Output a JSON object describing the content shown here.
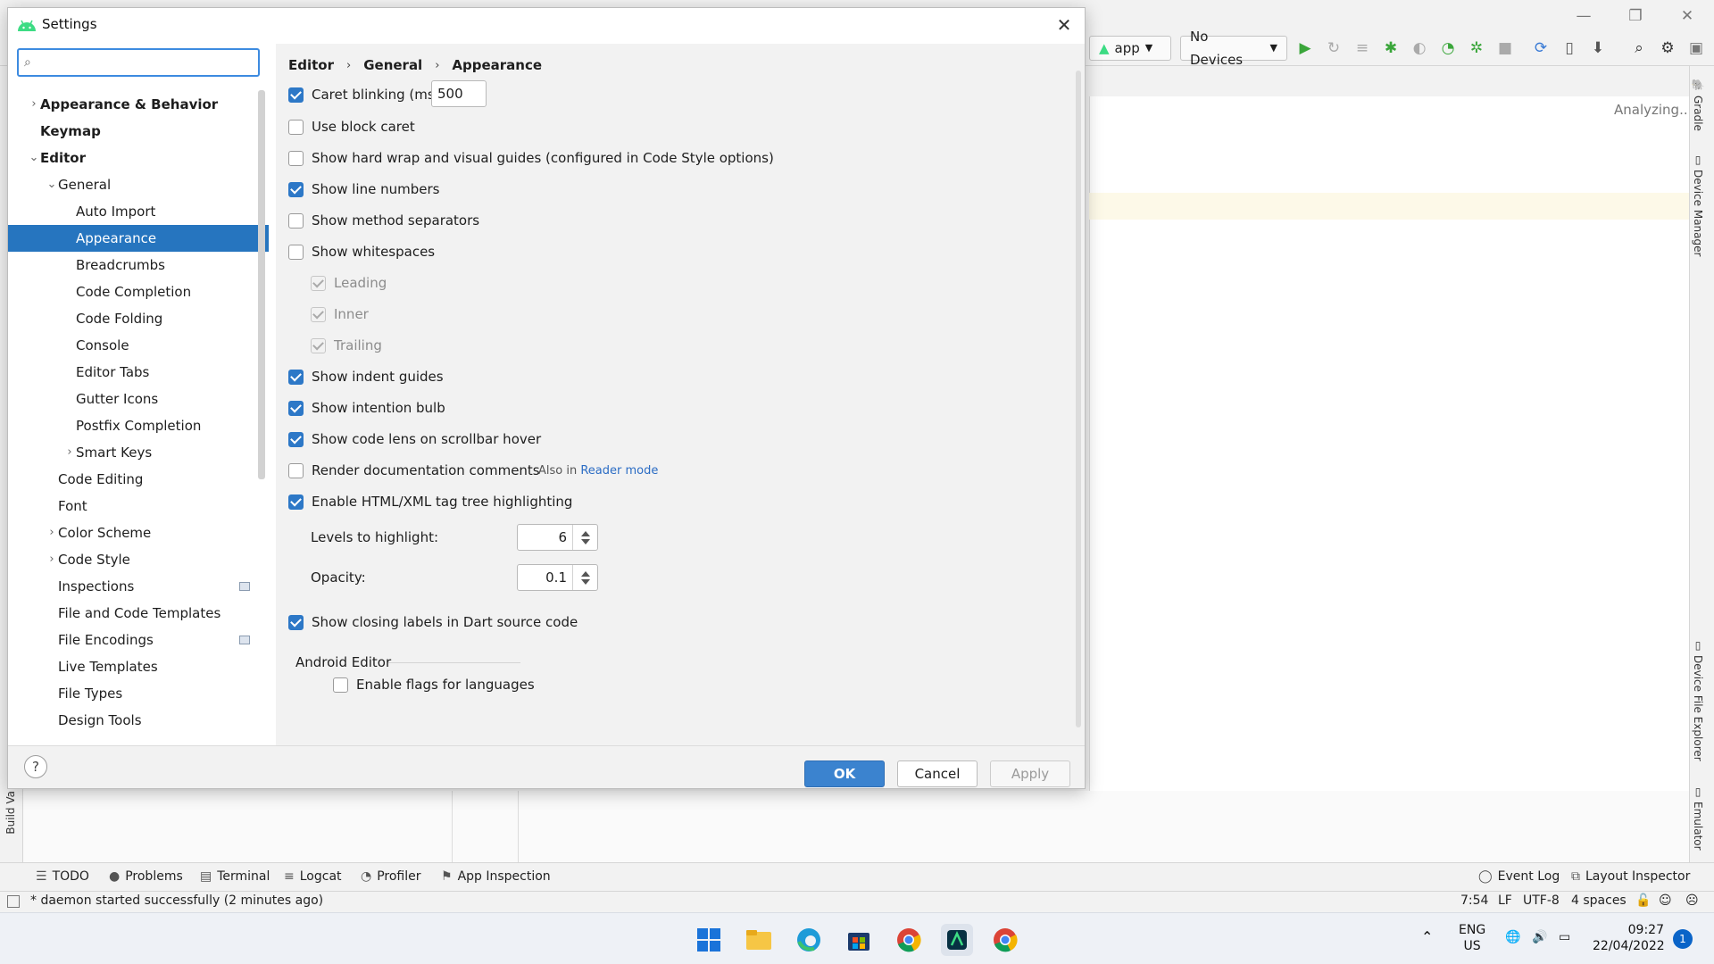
{
  "ide": {
    "run_config": "app",
    "devices": "No Devices",
    "analyzing": "Analyzing...",
    "right_tabs": [
      "Gradle",
      "Device Manager",
      "Device File Explorer",
      "Emulator"
    ],
    "left_tab": "Build Va",
    "tool_windows": [
      "TODO",
      "Problems",
      "Terminal",
      "Logcat",
      "Profiler",
      "App Inspection"
    ],
    "tool_windows_right": [
      "Event Log",
      "Layout Inspector"
    ],
    "status_message": "* daemon started successfully (2 minutes ago)",
    "status_items": [
      "7:54",
      "LF",
      "UTF-8",
      "4 spaces"
    ]
  },
  "taskbar": {
    "lang_top": "ENG",
    "lang_bottom": "US",
    "time": "09:27",
    "date": "22/04/2022",
    "notifications": "1"
  },
  "dialog": {
    "title": "Settings",
    "search": {
      "value": "",
      "placeholder": ""
    },
    "tree": [
      {
        "label": "Appearance & Behavior",
        "indent": 0,
        "bold": true,
        "chevron": "right"
      },
      {
        "label": "Keymap",
        "indent": 0,
        "bold": true,
        "chevron": "none"
      },
      {
        "label": "Editor",
        "indent": 0,
        "bold": true,
        "chevron": "down"
      },
      {
        "label": "General",
        "indent": 1,
        "bold": false,
        "chevron": "down"
      },
      {
        "label": "Auto Import",
        "indent": 2,
        "bold": false,
        "chevron": "none"
      },
      {
        "label": "Appearance",
        "indent": 2,
        "bold": false,
        "chevron": "none",
        "selected": true
      },
      {
        "label": "Breadcrumbs",
        "indent": 2,
        "bold": false,
        "chevron": "none"
      },
      {
        "label": "Code Completion",
        "indent": 2,
        "bold": false,
        "chevron": "none"
      },
      {
        "label": "Code Folding",
        "indent": 2,
        "bold": false,
        "chevron": "none"
      },
      {
        "label": "Console",
        "indent": 2,
        "bold": false,
        "chevron": "none"
      },
      {
        "label": "Editor Tabs",
        "indent": 2,
        "bold": false,
        "chevron": "none"
      },
      {
        "label": "Gutter Icons",
        "indent": 2,
        "bold": false,
        "chevron": "none"
      },
      {
        "label": "Postfix Completion",
        "indent": 2,
        "bold": false,
        "chevron": "none"
      },
      {
        "label": "Smart Keys",
        "indent": 2,
        "bold": false,
        "chevron": "right"
      },
      {
        "label": "Code Editing",
        "indent": 1,
        "bold": false,
        "chevron": "none"
      },
      {
        "label": "Font",
        "indent": 1,
        "bold": false,
        "chevron": "none"
      },
      {
        "label": "Color Scheme",
        "indent": 1,
        "bold": false,
        "chevron": "right"
      },
      {
        "label": "Code Style",
        "indent": 1,
        "bold": false,
        "chevron": "right"
      },
      {
        "label": "Inspections",
        "indent": 1,
        "bold": false,
        "chevron": "none",
        "project_icon": true
      },
      {
        "label": "File and Code Templates",
        "indent": 1,
        "bold": false,
        "chevron": "none"
      },
      {
        "label": "File Encodings",
        "indent": 1,
        "bold": false,
        "chevron": "none",
        "project_icon": true
      },
      {
        "label": "Live Templates",
        "indent": 1,
        "bold": false,
        "chevron": "none"
      },
      {
        "label": "File Types",
        "indent": 1,
        "bold": false,
        "chevron": "none"
      },
      {
        "label": "Design Tools",
        "indent": 1,
        "bold": false,
        "chevron": "none"
      }
    ],
    "breadcrumb": [
      "Editor",
      "General",
      "Appearance"
    ],
    "options": {
      "caret_blinking": {
        "label": "Caret blinking (ms):",
        "checked": true,
        "value": "500"
      },
      "block_caret": {
        "label": "Use block caret",
        "checked": false
      },
      "hard_wrap": {
        "label": "Show hard wrap and visual guides (configured in Code Style options)",
        "checked": false
      },
      "line_numbers": {
        "label": "Show line numbers",
        "checked": true
      },
      "method_separators": {
        "label": "Show method separators",
        "checked": false
      },
      "whitespaces": {
        "label": "Show whitespaces",
        "checked": false
      },
      "leading": {
        "label": "Leading",
        "checked": true,
        "disabled": true
      },
      "inner": {
        "label": "Inner",
        "checked": true,
        "disabled": true
      },
      "trailing": {
        "label": "Trailing",
        "checked": true,
        "disabled": true
      },
      "indent_guides": {
        "label": "Show indent guides",
        "checked": true
      },
      "intention_bulb": {
        "label": "Show intention bulb",
        "checked": true
      },
      "code_lens": {
        "label": "Show code lens on scrollbar hover",
        "checked": true
      },
      "render_docs": {
        "label": "Render documentation comments",
        "checked": false,
        "hint_prefix": "Also in",
        "hint_link": "Reader mode"
      },
      "tag_tree": {
        "label": "Enable HTML/XML tag tree highlighting",
        "checked": true
      },
      "levels": {
        "label": "Levels to highlight:",
        "value": "6"
      },
      "opacity": {
        "label": "Opacity:",
        "value": "0.1"
      },
      "closing_labels": {
        "label": "Show closing labels in Dart source code",
        "checked": true
      },
      "android_section": "Android Editor",
      "enable_flags": {
        "label": "Enable flags for languages",
        "checked": false
      }
    },
    "buttons": {
      "ok": "OK",
      "cancel": "Cancel",
      "apply": "Apply",
      "help": "?"
    }
  }
}
